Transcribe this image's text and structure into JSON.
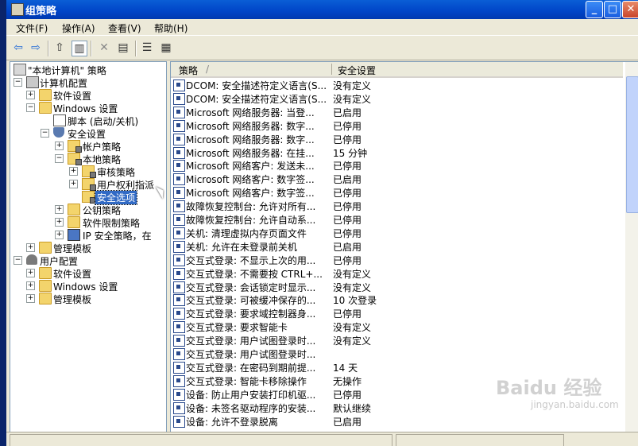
{
  "window": {
    "title": "组策略"
  },
  "menu": [
    "文件(F)",
    "操作(A)",
    "查看(V)",
    "帮助(H)"
  ],
  "toolbar": {
    "buttons": [
      "back-icon",
      "forward-icon",
      "up-icon",
      "show-tree-icon",
      "delete-icon",
      "export-icon",
      "properties-icon",
      "help-icon"
    ]
  },
  "tree": {
    "root": "\"本地计算机\" 策略",
    "computer_config": "计算机配置",
    "software_settings": "软件设置",
    "windows_settings": "Windows 设置",
    "scripts": "脚本 (启动/关机)",
    "security_settings": "安全设置",
    "account_policies": "帐户策略",
    "local_policies": "本地策略",
    "audit_policy": "审核策略",
    "user_rights": "用户权利指派",
    "security_options": "安全选项",
    "public_key": "公钥策略",
    "software_restriction": "软件限制策略",
    "ip_security": "IP 安全策略，在",
    "admin_templates": "管理模板",
    "user_config": "用户配置",
    "user_software_settings": "软件设置",
    "user_windows_settings": "Windows 设置",
    "user_admin_templates": "管理模板"
  },
  "list": {
    "columns": [
      "策略",
      "安全设置"
    ],
    "rows": [
      [
        "DCOM: 安全描述符定义语言(S...",
        "没有定义"
      ],
      [
        "DCOM: 安全描述符定义语言(S...",
        "没有定义"
      ],
      [
        "Microsoft 网络服务器: 当登...",
        "已启用"
      ],
      [
        "Microsoft 网络服务器: 数字...",
        "已停用"
      ],
      [
        "Microsoft 网络服务器: 数字...",
        "已停用"
      ],
      [
        "Microsoft 网络服务器: 在挂...",
        "15 分钟"
      ],
      [
        "Microsoft 网络客户: 发送未...",
        "已停用"
      ],
      [
        "Microsoft 网络客户: 数字签...",
        "已启用"
      ],
      [
        "Microsoft 网络客户: 数字签...",
        "已停用"
      ],
      [
        "故障恢复控制台: 允许对所有...",
        "已停用"
      ],
      [
        "故障恢复控制台: 允许自动系...",
        "已停用"
      ],
      [
        "关机: 清理虚拟内存页面文件",
        "已停用"
      ],
      [
        "关机: 允许在未登录前关机",
        "已启用"
      ],
      [
        "交互式登录: 不显示上次的用...",
        "已停用"
      ],
      [
        "交互式登录: 不需要按 CTRL+...",
        "没有定义"
      ],
      [
        "交互式登录: 会话锁定时显示...",
        "没有定义"
      ],
      [
        "交互式登录: 可被缓冲保存的...",
        "10 次登录"
      ],
      [
        "交互式登录: 要求域控制器身...",
        "已停用"
      ],
      [
        "交互式登录: 要求智能卡",
        "没有定义"
      ],
      [
        "交互式登录: 用户试图登录时...",
        "没有定义"
      ],
      [
        "交互式登录: 用户试图登录时...",
        ""
      ],
      [
        "交互式登录: 在密码到期前提...",
        "14 天"
      ],
      [
        "交互式登录: 智能卡移除操作",
        "无操作"
      ],
      [
        "设备: 防止用户安装打印机驱...",
        "已停用"
      ],
      [
        "设备: 未签名驱动程序的安装...",
        "默认继续"
      ],
      [
        "设备: 允许不登录脱离",
        "已启用"
      ]
    ]
  },
  "watermark": {
    "brand": "Baidu 经验",
    "url": "jingyan.baidu.com"
  }
}
